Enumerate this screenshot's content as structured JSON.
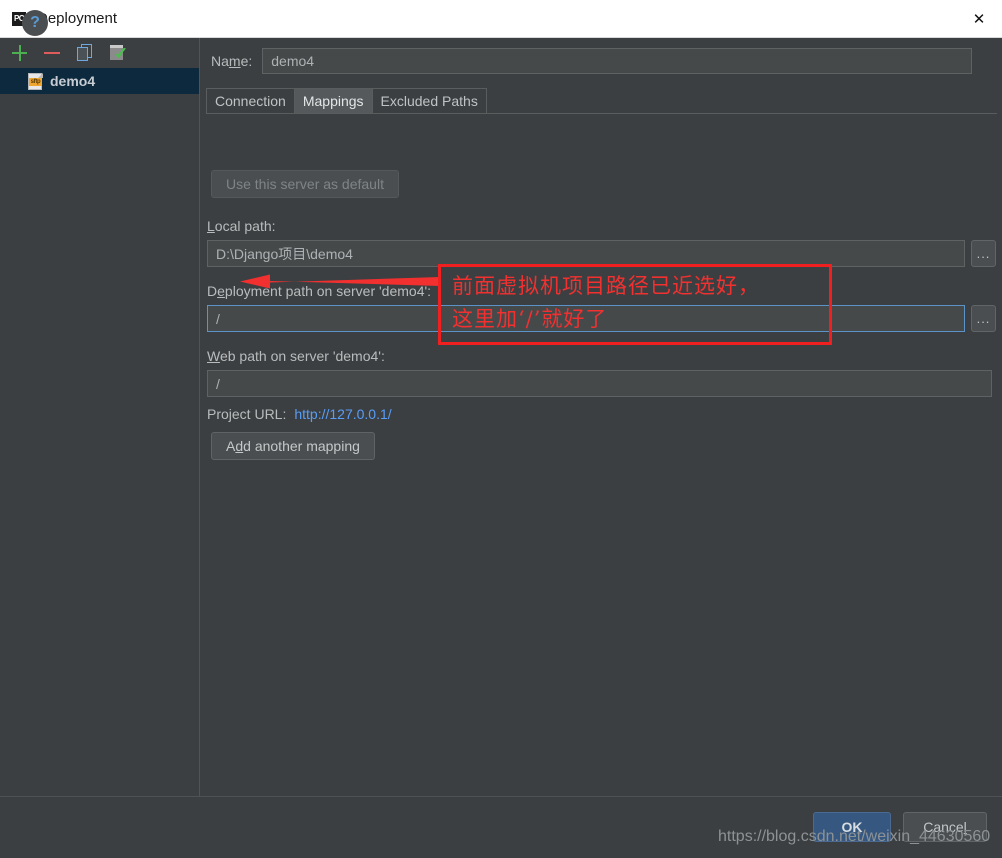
{
  "window": {
    "title": "Deployment",
    "app_icon": "pycharm-logo-icon",
    "close_icon": "close-icon"
  },
  "sidebar": {
    "toolbar": [
      {
        "name": "add",
        "icon": "plus-icon",
        "color": "#4caf50"
      },
      {
        "name": "remove",
        "icon": "minus-icon",
        "color": "#e05c5c"
      },
      {
        "name": "copy",
        "icon": "copy-icon",
        "color": "#6fa8dc"
      },
      {
        "name": "validate",
        "icon": "checklist-check-icon",
        "color": "#49c04b"
      }
    ],
    "items": [
      {
        "label": "demo4",
        "icon": "sftp-file-icon",
        "badge": "sftp",
        "selected": true
      }
    ]
  },
  "form": {
    "name_label": "Na",
    "name_label_mnemonic": "m",
    "name_label_rest": "e:",
    "name_value": "demo4",
    "tabs": [
      {
        "label": "Connection",
        "active": false
      },
      {
        "label": "Mappings",
        "active": true
      },
      {
        "label": "Excluded Paths",
        "active": false
      }
    ],
    "use_server_default_button": "Use this server as default",
    "local_path_label": "L",
    "local_path_label_mnemonic": "",
    "local_path_label_rest": "ocal path:",
    "local_path_value": "D:\\Django项目\\demo4",
    "deployment_path_label_pre": "D",
    "deployment_path_label_mnemonic": "e",
    "deployment_path_label_rest": "ployment path on server 'demo4':",
    "deployment_path_value": "/",
    "web_path_label_mnemonic": "W",
    "web_path_label_rest": "eb path on server 'demo4':",
    "web_path_value": "/",
    "project_url_label": "Project URL:",
    "project_url_value": "http://127.0.0.1/",
    "add_mapping_pre": "A",
    "add_mapping_mnemonic": "d",
    "add_mapping_rest": "d another mapping",
    "browse_button_label": "...",
    "browse_icon": "ellipsis-icon"
  },
  "annotation": {
    "line1": "前面虚拟机项目路径已近选好，",
    "line2": "这里加‘/’就好了",
    "color": "#f23030",
    "arrow_icon": "left-arrow-icon"
  },
  "footer": {
    "help_label": "?",
    "help_icon": "question-mark-icon",
    "ok_label": "OK",
    "cancel_pre": "Cance",
    "cancel_mnemonic": "l",
    "cancel_rest": "",
    "watermark": "https://blog.csdn.net/weixin_44630560"
  }
}
